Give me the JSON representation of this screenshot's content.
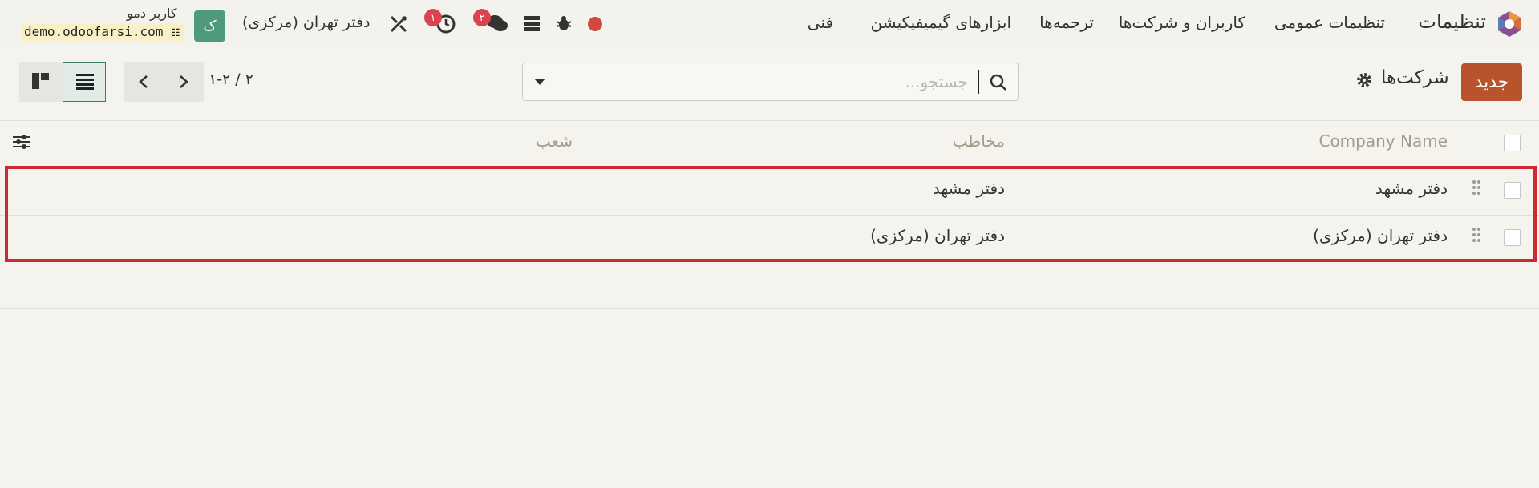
{
  "navbar": {
    "app_title": "تنظیمات",
    "menu": [
      "تنظیمات عمومی",
      "کاربران و شرکت‌ها",
      "ترجمه‌ها",
      "ابزارهای گیمیفیکیشن",
      "فنی"
    ],
    "company_switch": "دفتر تهران (مرکزی)",
    "activity_badge": "۱",
    "messages_badge": "۲",
    "user": {
      "initial": "ک",
      "name": "کاربر دمو",
      "database": "demo.odoofarsi.com"
    },
    "status_color": "#d04a3e"
  },
  "control_panel": {
    "new_button": "جدید",
    "breadcrumb": "شرکت‌ها",
    "search_placeholder": "جستجو...",
    "pager": "۱-۲ / ۲"
  },
  "list": {
    "columns": {
      "name": "Company Name",
      "partner": "مخاطب",
      "branches": "شعب"
    },
    "rows": [
      {
        "name": "دفتر مشهد",
        "partner": "دفتر مشهد",
        "branches": ""
      },
      {
        "name": "دفتر تهران (مرکزی)",
        "partner": "دفتر تهران (مرکزی)",
        "branches": ""
      }
    ]
  },
  "colors": {
    "brand": "#b8532c",
    "avatar": "#4f9a7a",
    "badge": "#d9434f",
    "highlight": "#cc2a33"
  }
}
